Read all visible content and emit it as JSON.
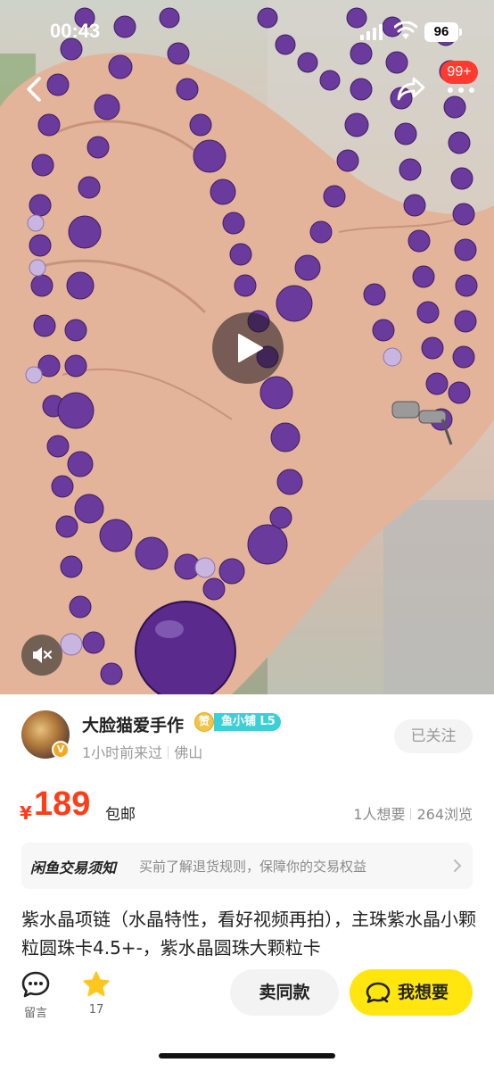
{
  "status_bar": {
    "time": "00:43",
    "battery": "96"
  },
  "top_nav": {
    "notification_count": "99+"
  },
  "icons": {
    "back": "chevron-left-icon",
    "share": "share-arrow-icon",
    "more": "more-dots-icon",
    "play": "play-icon",
    "mute": "speaker-muted-icon",
    "comment": "chat-bubble-icon",
    "favorite": "star-icon",
    "want": "chat-bubble-outline-icon"
  },
  "seller": {
    "name": "大脸猫爱手作",
    "avatar_badge": "V",
    "zan_badge": "赞",
    "level": "鱼小铺 L5",
    "last_visit": "1小时前来过",
    "location": "佛山",
    "follow_label": "已关注"
  },
  "price": {
    "currency": "¥",
    "amount": "189",
    "shipping": "包邮",
    "wants": "1人想要",
    "views": "264浏览"
  },
  "notice": {
    "title": "闲鱼交易须知",
    "text": "买前了解退货规则，保障你的交易权益"
  },
  "description": "紫水晶项链（水晶特性，看好视频再拍），主珠紫水晶小颗粒圆珠卡4.5+-，紫水晶圆珠大颗粒卡",
  "bottom_bar": {
    "comment_label": "留言",
    "favorite_count": "17",
    "same_item_label": "卖同款",
    "want_label": "我想要"
  },
  "colors": {
    "price_red": "#ff3d19",
    "want_yellow": "#ffe60f",
    "level_cyan": "#39d0d8",
    "badge_red": "#ff3b30",
    "star_yellow": "#ffc71e"
  }
}
